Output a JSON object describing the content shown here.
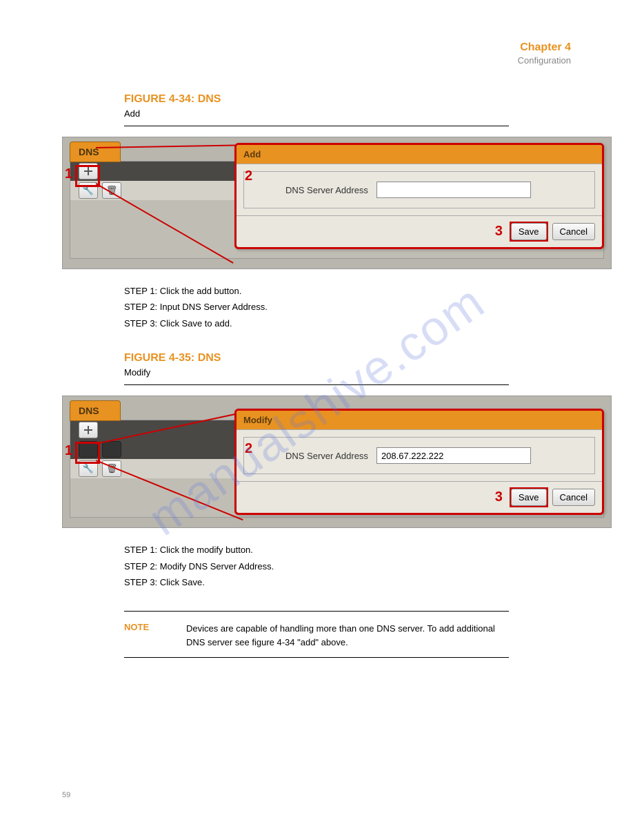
{
  "chapter": {
    "title": "Chapter 4",
    "subtitle": "Configuration"
  },
  "fig1": {
    "heading": "FIGURE 4-34: DNS",
    "sub": "Add",
    "tab": "DNS",
    "dialog_title": "Add",
    "field_label": "DNS Server Address",
    "field_value": "",
    "save": "Save",
    "cancel": "Cancel",
    "m1": "1",
    "m2": "2",
    "m3": "3",
    "steps": "STEP 1: Click the add button.\nSTEP 2: Input DNS Server Address.\nSTEP 3: Click Save to add."
  },
  "fig2": {
    "heading": "FIGURE 4-35: DNS",
    "sub": "Modify",
    "tab": "DNS",
    "dialog_title": "Modify",
    "field_label": "DNS Server Address",
    "field_value": "208.67.222.222",
    "save": "Save",
    "cancel": "Cancel",
    "m1": "1",
    "m2": "2",
    "m3": "3",
    "steps": "STEP 1: Click the modify button.\nSTEP 2: Modify DNS Server Address.\nSTEP 3: Click Save."
  },
  "noteTitle": "NOTE",
  "noteBody": "Devices are capable of handling more than one DNS server. To add additional DNS server see figure 4-34 \"add\" above.",
  "pageNum": "59"
}
